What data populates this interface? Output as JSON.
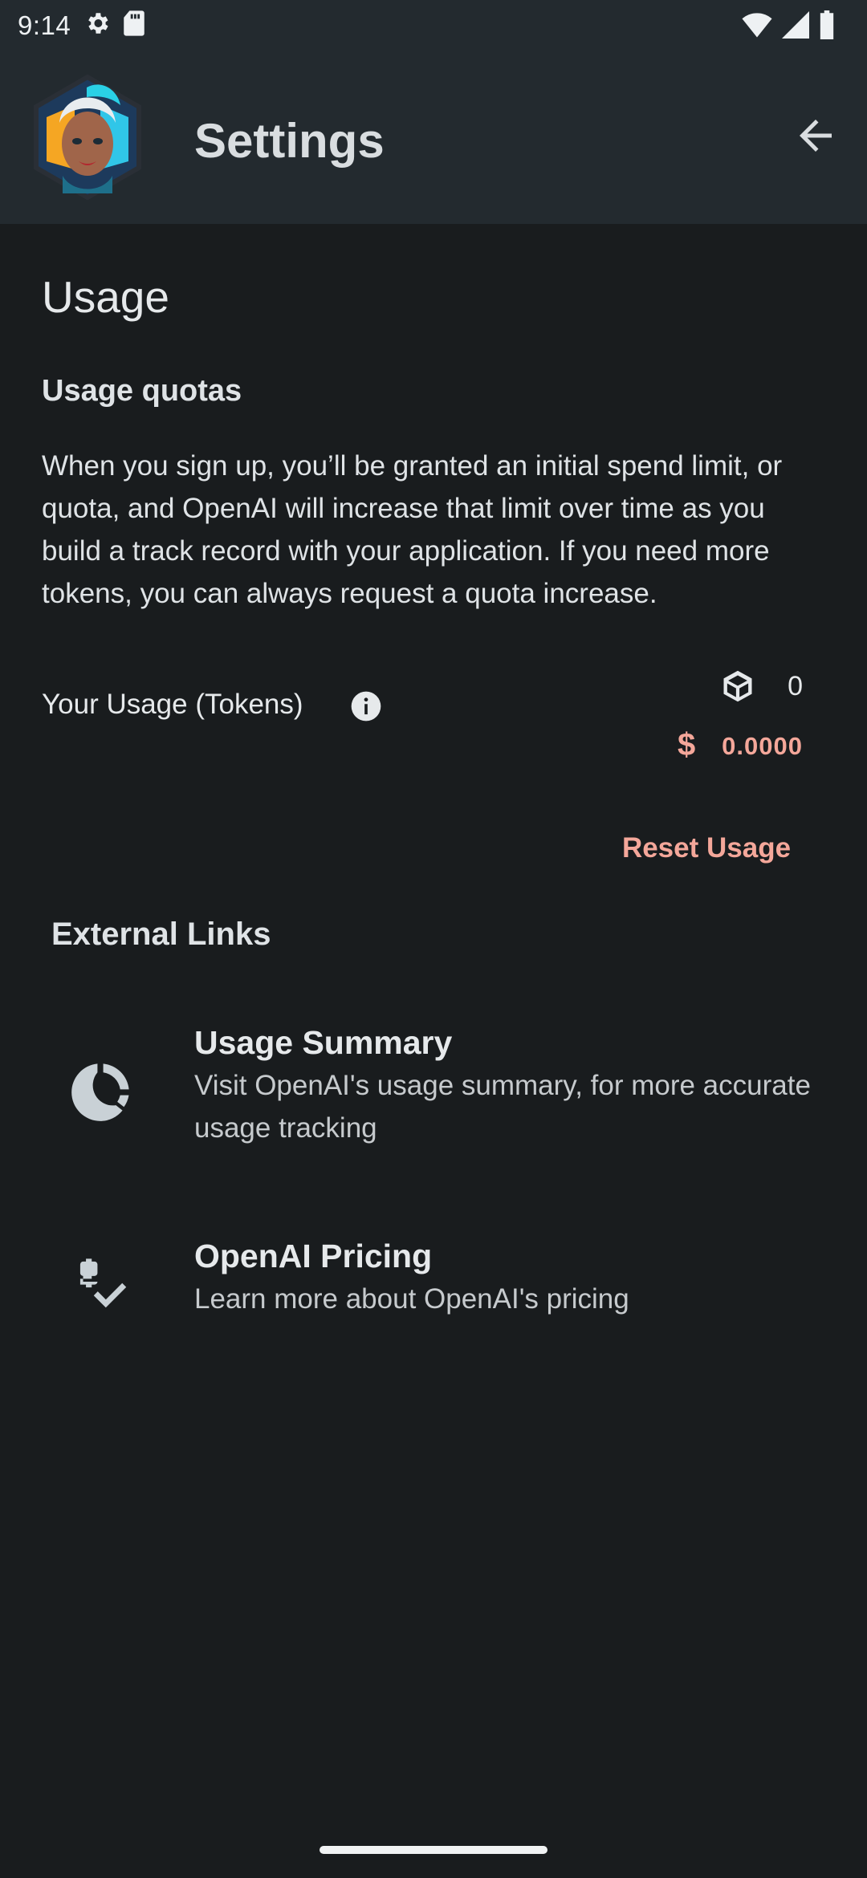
{
  "status_bar": {
    "time": "9:14",
    "left_icons": [
      "settings-icon",
      "sd-card-icon"
    ],
    "right_icons": [
      "wifi-icon",
      "signal-icon",
      "battery-icon"
    ]
  },
  "app_bar": {
    "title": "Settings",
    "avatar_icon": "character-avatar",
    "back_icon": "arrow-back-icon"
  },
  "usage": {
    "heading": "Usage",
    "quota_title": "Usage quotas",
    "quota_text": "When you sign up, you’ll be granted an initial spend limit, or quota, and OpenAI will increase that limit over time as you build a track record with your application. If you need more tokens, you can always request a quota increase.",
    "tokens_label": "Your Usage (Tokens)",
    "token_count": "0",
    "currency_symbol": "$",
    "cost": "0.0000",
    "reset_label": "Reset Usage"
  },
  "external_links": {
    "heading": "External Links",
    "items": [
      {
        "title": "Usage Summary",
        "subtitle": "Visit OpenAI's usage summary, for more accurate usage tracking",
        "icon": "donut-chart-icon"
      },
      {
        "title": "OpenAI Pricing",
        "subtitle": "Learn more about OpenAI's pricing",
        "icon": "price-check-icon"
      }
    ]
  },
  "colors": {
    "background": "#191c1e",
    "bar": "#232a2f",
    "accent": "#f4a79a",
    "text": "#e1e3e5"
  }
}
